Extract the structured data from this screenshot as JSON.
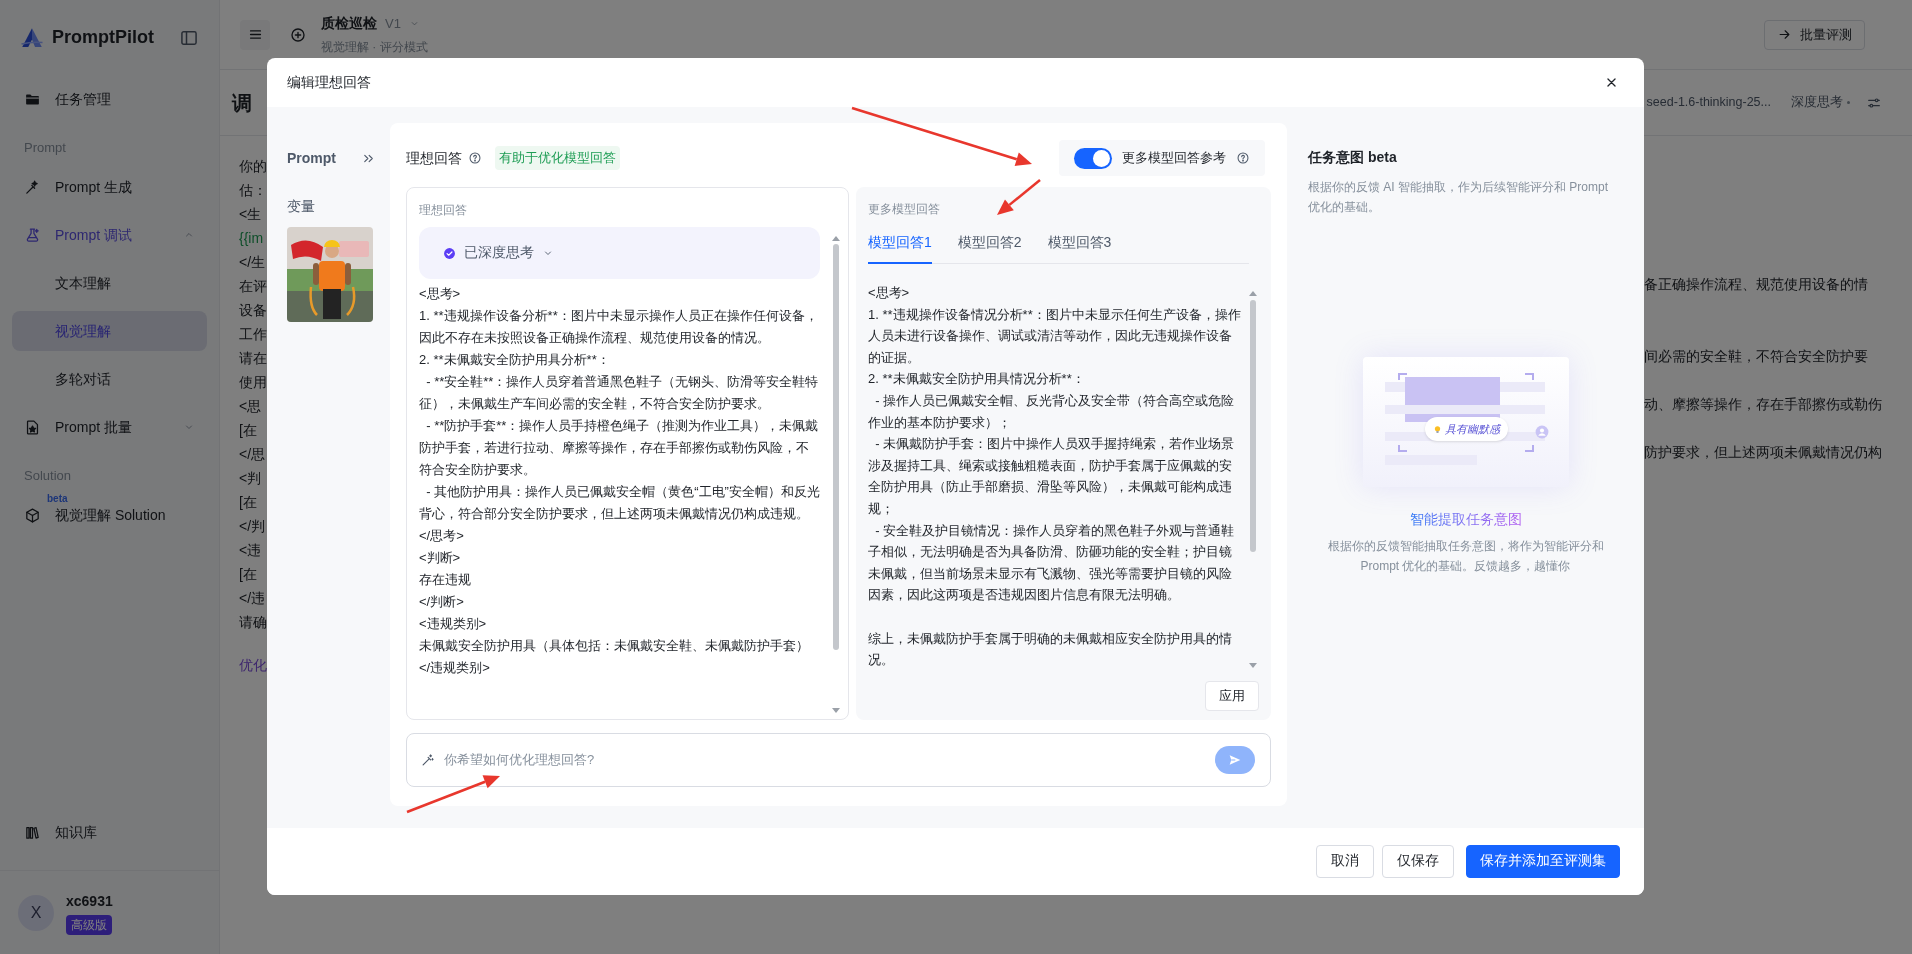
{
  "sidebar": {
    "brand": "PromptPilot",
    "items": [
      {
        "label": "任务管理",
        "selected": false
      }
    ],
    "sections": [
      {
        "title": "Prompt",
        "items": [
          {
            "label": "Prompt 生成",
            "selected": false
          },
          {
            "label": "Prompt 调试",
            "selected": false,
            "expanded": true,
            "children": [
              {
                "label": "文本理解",
                "selected": false
              },
              {
                "label": "视觉理解",
                "selected": true
              },
              {
                "label": "多轮对话",
                "selected": false
              }
            ]
          },
          {
            "label": "Prompt 批量",
            "selected": false,
            "expanded": false
          }
        ]
      },
      {
        "title": "Solution",
        "items": [
          {
            "label": "视觉理解 Solution",
            "selected": false,
            "badge": "beta"
          }
        ]
      }
    ],
    "bottom_items": [
      {
        "label": "知识库",
        "selected": false
      }
    ],
    "user": {
      "avatar": "X",
      "name": "xc6931",
      "plan": "高级版"
    }
  },
  "header": {
    "title": "质检巡检",
    "version": "V1",
    "subtitle": "视觉理解 · 评分模式",
    "batch_button": "批量评测"
  },
  "page": {
    "heading": "调",
    "model": "seed-1.6-thinking-25...",
    "mode": "深度思考",
    "prompt_lines": [
      {
        "text": "你的",
        "kind": "text"
      },
      {
        "text": "估：",
        "kind": "text"
      },
      {
        "text": "<生",
        "kind": "text"
      },
      {
        "text": "{{im",
        "kind": "variable"
      },
      {
        "text": "</生",
        "kind": "text"
      },
      {
        "text": "在评",
        "kind": "text"
      },
      {
        "text": "设备",
        "kind": "text"
      },
      {
        "text": "工作",
        "kind": "text"
      },
      {
        "text": "请在",
        "kind": "text"
      },
      {
        "text": "使用",
        "kind": "text"
      },
      {
        "text": "<思",
        "kind": "text"
      },
      {
        "text": "[在",
        "kind": "text"
      },
      {
        "text": "</思",
        "kind": "text"
      },
      {
        "text": "<判",
        "kind": "text"
      },
      {
        "text": "[在",
        "kind": "text"
      },
      {
        "text": "</判",
        "kind": "text"
      },
      {
        "text": "<违",
        "kind": "text"
      },
      {
        "text": "[在",
        "kind": "text"
      },
      {
        "text": "</违",
        "kind": "text"
      },
      {
        "text": "请确",
        "kind": "text"
      }
    ],
    "optimize_link": "优化",
    "right_lines": [
      "备正确操作流程、规范使用设备的情",
      "间必需的安全鞋，不符合安全防护要",
      "动、摩擦等操作，存在手部擦伤或勒伤",
      "防护要求，但上述两项未佩戴情况仍构"
    ]
  },
  "dialog": {
    "title": "编辑理想回答",
    "prompt_label": "Prompt",
    "variables_label": "变量",
    "ideal": {
      "title": "理想回答",
      "tag": "有助于优化模型回答",
      "box_label": "理想回答",
      "thinking": "已深度思考",
      "lines": [
        "<思考>",
        "1. **违规操作设备分析**：图片中未显示操作人员正在操作任何设备，因此不存在未按照设备正确操作流程、规范使用设备的情况。",
        "2. **未佩戴安全防护用具分析**：",
        "  - **安全鞋**：操作人员穿着普通黑色鞋子（无钢头、防滑等安全鞋特征），未佩戴生产车间必需的安全鞋，不符合安全防护要求。",
        "  - **防护手套**：操作人员手持橙色绳子（推测为作业工具），未佩戴防护手套，若进行拉动、摩擦等操作，存在手部擦伤或勒伤风险，不符合安全防护要求。",
        "  - 其他防护用具：操作人员已佩戴安全帽（黄色“工电”安全帽）和反光背心，符合部分安全防护要求，但上述两项未佩戴情况仍构成违规。",
        "</思考>",
        "<判断>",
        "存在违规",
        "</判断>",
        "<违规类别>",
        "未佩戴安全防护用具（具体包括：未佩戴安全鞋、未佩戴防护手套）",
        "</违规类别>"
      ]
    },
    "more": {
      "on": true,
      "label": "更多模型回答参考",
      "box_label": "更多模型回答",
      "tabs": [
        {
          "label": "模型回答1",
          "selected": true
        },
        {
          "label": "模型回答2",
          "selected": false
        },
        {
          "label": "模型回答3",
          "selected": false
        }
      ],
      "paragraphs": [
        [
          "<思考>",
          "1. **违规操作设备情况分析**：图片中未显示任何生产设备，操作人员未进行设备操作、调试或清洁等动作，因此无违规操作设备的证据。",
          "2. **未佩戴安全防护用具情况分析**：",
          "  - 操作人员已佩戴安全帽、反光背心及安全带（符合高空或危险作业的基本防护要求）；",
          "  - 未佩戴防护手套：图片中操作人员双手握持绳索，若作业场景涉及握持工具、绳索或接触粗糙表面，防护手套属于应佩戴的安全防护用具（防止手部磨损、滑坠等风险），未佩戴可能构成违规；",
          "  - 安全鞋及护目镜情况：操作人员穿着的黑色鞋子外观与普通鞋子相似，无法明确是否为具备防滑、防砸功能的安全鞋；护目镜未佩戴，但当前场景未显示有飞溅物、强光等需要护目镜的风险因素，因此这两项是否违规因图片信息有限无法明确。"
        ],
        [
          "综上，未佩戴防护手套属于明确的未佩戴相应安全防护用具的情况。"
        ]
      ],
      "apply": "应用"
    },
    "input": {
      "placeholder": "你希望如何优化理想回答?"
    },
    "intent": {
      "title": "任务意图 beta",
      "description": "根据你的反馈 AI 智能抽取，作为后续智能评分和 Prompt 优化的基础。",
      "bubble": "具有幽默感",
      "heading": "智能提取任务意图",
      "text": "根据你的反馈智能抽取任务意图，将作为智能评分和 Prompt 优化的基础。反馈越多，越懂你"
    },
    "buttons": [
      {
        "label": "取消",
        "kind": "default"
      },
      {
        "label": "仅保存",
        "kind": "default"
      },
      {
        "label": "保存并添加至评测集",
        "kind": "primary"
      }
    ]
  }
}
